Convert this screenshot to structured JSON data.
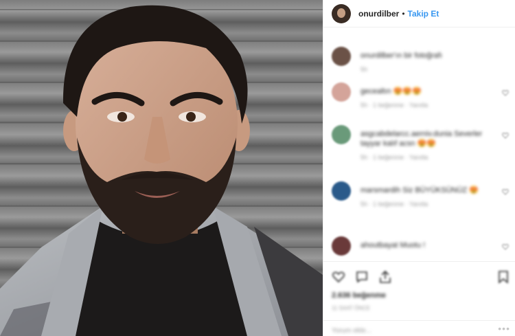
{
  "header": {
    "username": "onurdilber",
    "separator": "•",
    "follow_label": "Takip Et"
  },
  "comments": [
    {
      "text": "onurdilber'ın bir fotoğrafı",
      "meta": "5h",
      "avatar_color": "#6b5247"
    },
    {
      "text": "gecealtın 😍😍😍",
      "meta": "5h · 1 beğenme · Yanıtla",
      "avatar_color": "#d4a49a"
    },
    {
      "text": "asgcabdelarcc.aerniv.dunia Severler tayyar kalıf acsn 😍😍",
      "meta": "5h · 1 beğenme · Yanıtla",
      "avatar_color": "#6a9a7a"
    },
    {
      "text": "marsmardih Siz BÜYÜKSÜNÜZ 😍",
      "meta": "5h · 1 beğenme · Yanıtla",
      "avatar_color": "#2a5a8a"
    },
    {
      "text": "ahoutbayat Muotu !",
      "meta": "",
      "avatar_color": "#6a3a3a"
    }
  ],
  "likes": "2.636 beğenme",
  "time_ago": "11 SAAT ÖNCE",
  "add_comment_placeholder": "Yorum ekle...",
  "more_label": "•••"
}
